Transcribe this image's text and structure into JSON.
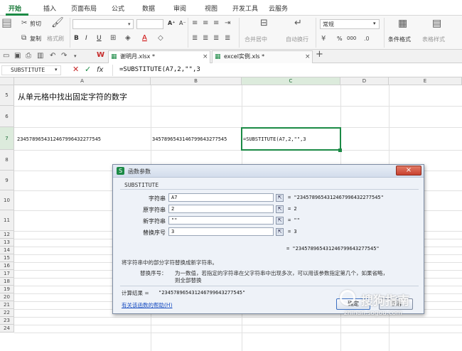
{
  "menu": {
    "tabs": [
      "开始",
      "插入",
      "页面布局",
      "公式",
      "数据",
      "审阅",
      "视图",
      "开发工具",
      "云服务"
    ],
    "active": "开始"
  },
  "ribbon": {
    "cut": "剪切",
    "copy": "复制",
    "format_painter": "格式刷",
    "bold": "B",
    "italic": "I",
    "underline": "U",
    "font_grow": "A⁺",
    "font_shrink": "A⁻",
    "merge_center": "合并居中",
    "wrap_text": "自动换行",
    "number_format": "常规",
    "percent": "%",
    "thousands": "000",
    "conditional_format": "条件格式",
    "table_style": "表格样式"
  },
  "doc_tabs": [
    {
      "label": "谢明月.xlsx *"
    },
    {
      "label": "excel实例.xls *"
    }
  ],
  "formula_bar": {
    "name_box": "SUBSTITUTE",
    "fx": "fx",
    "formula": "=SUBSTITUTE(A7,2,\"\",3"
  },
  "sheet": {
    "columns": [
      "A",
      "B",
      "C",
      "D",
      "E"
    ],
    "rows": [
      "5",
      "6",
      "7",
      "8",
      "9",
      "10",
      "11",
      "12",
      "13",
      "14",
      "15",
      "16",
      "17",
      "18",
      "19",
      "20",
      "21",
      "22",
      "23",
      "24"
    ],
    "cell_a5": "从单元格中找出固定字符的数字",
    "cell_a7": "23457896543124679964322​77545",
    "cell_b7": "34578965431467996432​77545",
    "cell_c7": "=SUBSTITUTE(A7,2,\"\",3"
  },
  "dialog": {
    "title": "函数参数",
    "function_name": "SUBSTITUTE",
    "args": [
      {
        "label": "字符串",
        "value": "A7",
        "result": "= \"23457896543124679964322​77545\""
      },
      {
        "label": "原字符串",
        "value": "2",
        "result": "= 2"
      },
      {
        "label": "新字符串",
        "value": "\"\"",
        "result": "= \"\""
      },
      {
        "label": "替换序号",
        "value": "3",
        "result": "= 3"
      }
    ],
    "overall_result": "= \"2345789654312467996432​77545\"",
    "description": "将字符串中的部分字符替换成新字符串。",
    "param_name": "替换序号：",
    "param_desc_line1": "为一数值，若指定的字符串在父字符串中出现多次，可以用该参数指定第几个，如果省略，",
    "param_desc_line2": "则全部替换",
    "calc_label": "计算结果 =",
    "calc_value": "\"2345789654312467996432​77545\"",
    "help_link": "有关该函数的帮助(H)",
    "ok": "确定",
    "cancel": "取消",
    "close": "×"
  },
  "watermark": {
    "title": "搜狗指南",
    "url": "zhinan.sogou.com"
  },
  "colors": {
    "accent": "#1b8a45",
    "selection": "#1b8a45",
    "dialog_bg": "#eef2f8",
    "close_btn": "#c8412f"
  }
}
